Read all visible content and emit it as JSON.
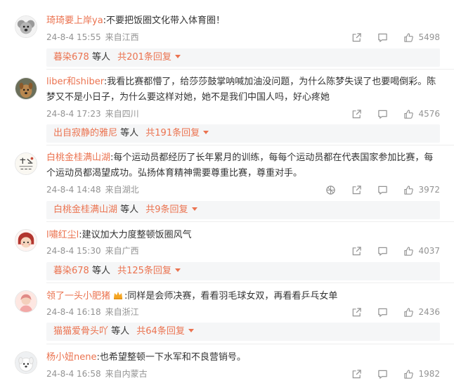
{
  "colors": {
    "accent": "#eb7350",
    "meta": "#939393",
    "replybar_bg": "#f5f6f7"
  },
  "comments": [
    {
      "avatar_icon": "koala-avatar",
      "user": "琦琦要上岸ya",
      "text": ":不要把饭圈文化带入体育圈！",
      "time": "24-8-4 15:55",
      "location": "来自江西",
      "likes": "5498",
      "reply_user": "暮染678",
      "reply_mid": " 等人 ",
      "reply_more": "共201条回复"
    },
    {
      "avatar_icon": "dog-avatar",
      "user": "liber和shiber",
      "text": ":我看比赛都懵了，给莎莎鼓掌呐喊加油没问题，为什么陈梦失误了也要喝倒彩。陈梦又不是小日子，为什么要这样对她，她不是我们中国人吗，好心疼她",
      "time": "24-8-4 17:23",
      "location": "来自四川",
      "likes": "4576",
      "reply_user": "出自寂静的雅尼",
      "reply_mid": " 等人 ",
      "reply_more": "共191条回复"
    },
    {
      "avatar_icon": "calligraphy-avatar",
      "user": "白桃金桂满山湖",
      "text": ":每个运动员都经历了长年累月的训练，每每个运动员都在代表国家参加比赛，每个运动员都渴望成功。弘扬体育精神需要尊重比赛，尊重对手。",
      "time": "24-8-4 14:48",
      "location": "来自湖北",
      "likes": "3972",
      "reply_user": "白桃金桂满山湖",
      "reply_mid": " 等人 ",
      "reply_more": "共9条回复"
    },
    {
      "avatar_icon": "cartoon-girl-avatar",
      "user": "l嘯红尘l",
      "text": ":建议加大力度整顿饭圈风气",
      "time": "24-8-4 15:30",
      "location": "来自广西",
      "likes": "4037",
      "reply_user": "暮染678",
      "reply_mid": " 等人 ",
      "reply_more": "共125条回复"
    },
    {
      "avatar_icon": "pink-girl-avatar",
      "user": "领了一头小肥猪",
      "badge_icon": "crown-badge-icon",
      "text": ":同样是会师决赛，看看羽毛球女双，再看看乒乓女单",
      "time": "24-8-4 16:18",
      "location": "来自浙江",
      "likes": "2436",
      "reply_user": "猫猫爱骨头吖",
      "reply_mid": " 等人 ",
      "reply_more": "共64条回复"
    },
    {
      "avatar_icon": "white-dog-avatar",
      "user": "杨小妞nene",
      "text": ":也希望整顿一下水军和不良营销号。",
      "time": "24-8-4 16:58",
      "location": "来自内蒙古",
      "likes": "1982"
    }
  ]
}
